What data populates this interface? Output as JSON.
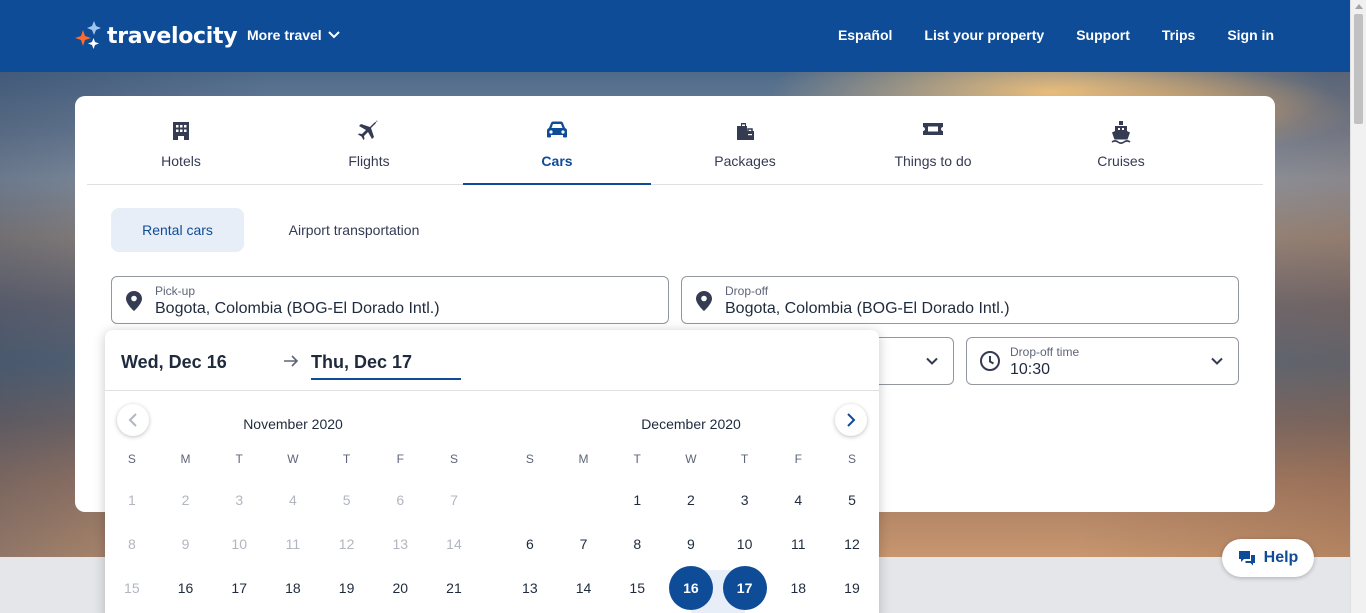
{
  "header": {
    "logo_text": "travelocity",
    "more_travel": "More travel",
    "nav": [
      "Español",
      "List your property",
      "Support",
      "Trips",
      "Sign in"
    ]
  },
  "tabs": [
    {
      "label": "Hotels",
      "icon": "hotel-icon"
    },
    {
      "label": "Flights",
      "icon": "plane-icon"
    },
    {
      "label": "Cars",
      "icon": "car-icon",
      "active": true
    },
    {
      "label": "Packages",
      "icon": "packages-icon"
    },
    {
      "label": "Things to do",
      "icon": "ticket-icon"
    },
    {
      "label": "Cruises",
      "icon": "cruise-icon"
    }
  ],
  "subtabs": {
    "rental_cars": "Rental cars",
    "airport_transportation": "Airport transportation"
  },
  "fields": {
    "pickup": {
      "label": "Pick-up",
      "value": "Bogota, Colombia (BOG-El Dorado Intl.)"
    },
    "dropoff": {
      "label": "Drop-off",
      "value": "Bogota, Colombia (BOG-El Dorado Intl.)"
    },
    "dropoff_time": {
      "label": "Drop-off time",
      "value": "10:30"
    }
  },
  "datepicker": {
    "start": "Wed, Dec 16",
    "end": "Thu, Dec 17",
    "weekdays": [
      "S",
      "M",
      "T",
      "W",
      "T",
      "F",
      "S"
    ],
    "months": [
      {
        "title": "November 2020",
        "weeks": [
          [
            "1",
            "2",
            "3",
            "4",
            "5",
            "6",
            "7"
          ],
          [
            "8",
            "9",
            "10",
            "11",
            "12",
            "13",
            "14"
          ],
          [
            "15",
            "16",
            "17",
            "18",
            "19",
            "20",
            "21"
          ]
        ]
      },
      {
        "title": "December 2020",
        "weeks": [
          [
            "",
            "",
            "1",
            "2",
            "3",
            "4",
            "5"
          ],
          [
            "6",
            "7",
            "8",
            "9",
            "10",
            "11",
            "12"
          ],
          [
            "13",
            "14",
            "15",
            "16",
            "17",
            "18",
            "19"
          ]
        ]
      }
    ],
    "selected": [
      "16",
      "17"
    ]
  },
  "help": {
    "label": "Help"
  },
  "colors": {
    "brand": "#0f4c97",
    "accent_light": "#e7eef8",
    "logo_orange": "#ff6b2c"
  }
}
